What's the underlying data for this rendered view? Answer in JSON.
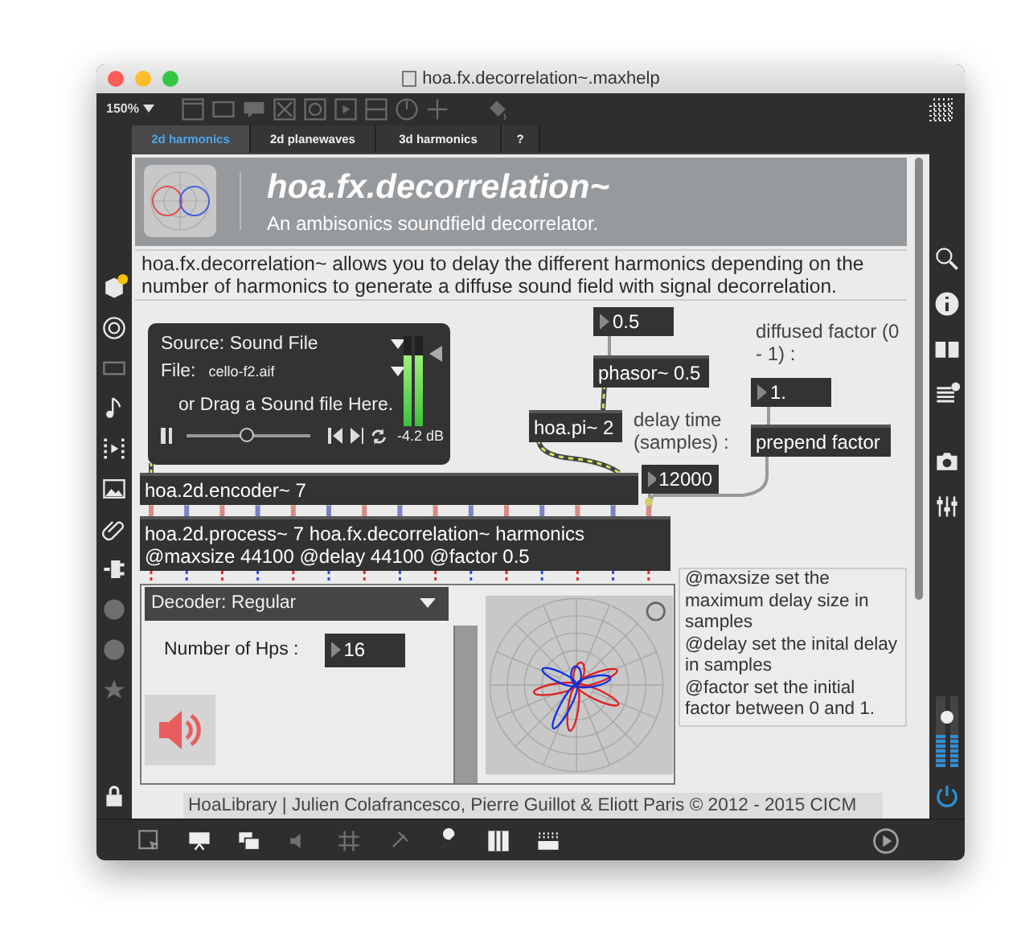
{
  "window": {
    "title": "hoa.fx.decorrelation~.maxhelp"
  },
  "toolbar": {
    "zoom": "150%"
  },
  "tabs": [
    {
      "label": "2d harmonics",
      "selected": true
    },
    {
      "label": "2d planewaves",
      "selected": false
    },
    {
      "label": "3d harmonics",
      "selected": false
    },
    {
      "label": "?",
      "selected": false
    }
  ],
  "header": {
    "title": "hoa.fx.decorrelation~",
    "subtitle": "An ambisonics soundfield decorrelator."
  },
  "description": "hoa.fx.decorrelation~ allows you to delay the different harmonics depending on the number of harmonics to generate a diffuse sound field with signal decorrelation.",
  "player": {
    "source": "Source: Sound File",
    "file_label": "File:",
    "file": "cello-f2.aif",
    "drop_hint": "or Drag a Sound file Here.",
    "position": {
      "level": 0.47
    },
    "meter": {
      "level": 0.78
    },
    "reading": "-4.2 dB"
  },
  "objects": [
    {
      "kind": "number",
      "text": "0.5"
    },
    {
      "kind": "object",
      "text": "phasor~ 0.5"
    },
    {
      "kind": "comment",
      "text": "diffused factor (0 - 1) :"
    },
    {
      "kind": "number",
      "text": "1."
    },
    {
      "kind": "object",
      "text": "prepend factor"
    },
    {
      "kind": "object",
      "text": "hoa.pi~ 2"
    },
    {
      "kind": "comment",
      "text": "delay time (samples) :"
    },
    {
      "kind": "number",
      "text": "12000"
    },
    {
      "kind": "object",
      "text": "hoa.2d.encoder~ 7"
    },
    {
      "kind": "object",
      "text": "hoa.2d.process~ 7 hoa.fx.decorrelation~ harmonics @maxsize 44100 @delay 44100 @factor 0.5"
    }
  ],
  "decoder": {
    "mode": "Decoder: Regular",
    "hps_label": "Number of Hps :",
    "hps_value": "16",
    "slider": {
      "level": 1
    }
  },
  "notes": [
    "@maxsize set the maximum delay size in samples",
    "@delay set the inital delay in samples",
    "@factor set the initial factor between 0 and 1."
  ],
  "footer": "HoaLibrary | Julien Colafrancesco, Pierre Guillot & Eliott Paris © 2012 - 2015 CICM",
  "master": {
    "gain": {
      "level": 0.7
    },
    "meter": {
      "level": 0.45
    }
  }
}
